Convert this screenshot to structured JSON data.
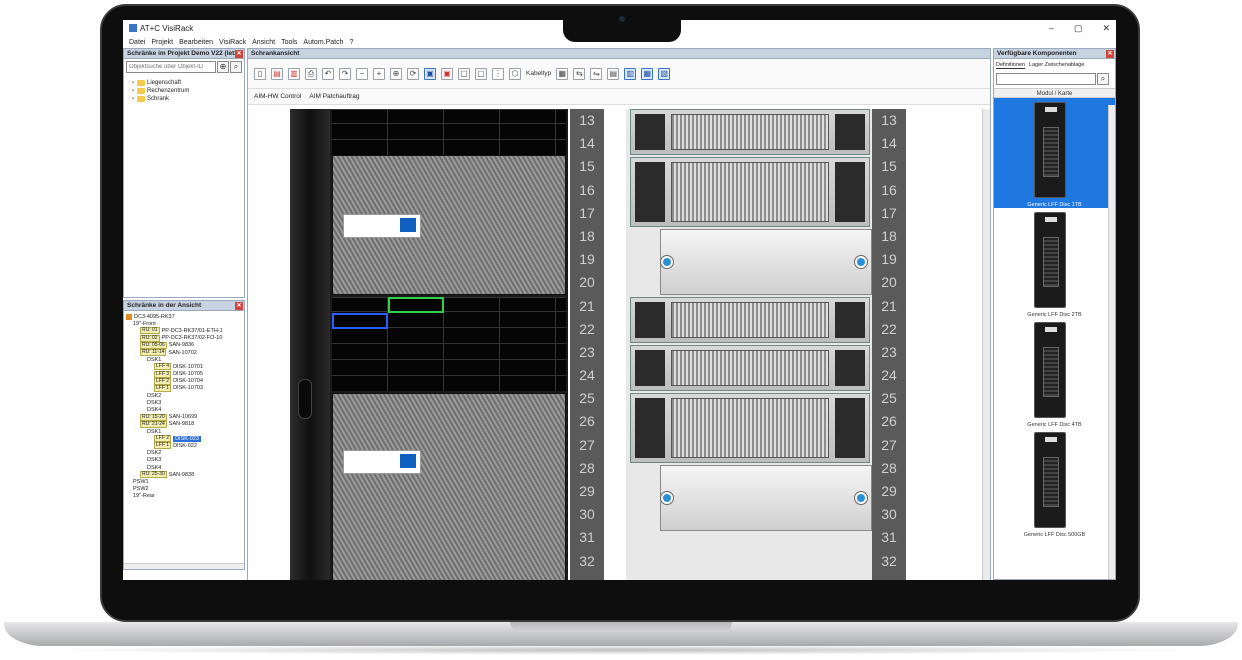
{
  "window": {
    "title": "AT+C VisiRack",
    "minimize": "–",
    "maximize": "▢",
    "close": "✕"
  },
  "menu": [
    "Datei",
    "Projekt",
    "Bearbeiten",
    "VisiRack",
    "Ansicht",
    "Tools",
    "Autom.Patch",
    "?"
  ],
  "left_top": {
    "title": "Schränke im Projekt Demo V22 (letzt",
    "search_placeholder": "Objektsuche über Objekt-ID",
    "tree": [
      "Liegenschaft",
      "Rechenzentrum",
      "Schrank"
    ]
  },
  "left_bottom": {
    "title": "Schränke in der Ansicht",
    "rows": [
      {
        "indent": 0,
        "tag": "",
        "text": "DC3-4095-RK37",
        "icon": true
      },
      {
        "indent": 1,
        "tag": "",
        "text": "19\"-Front"
      },
      {
        "indent": 2,
        "tag": "RU: 01",
        "text": "PP-DC3-RK37/01-ETH-1"
      },
      {
        "indent": 2,
        "tag": "RU: 02",
        "text": "PP-DC3-RK37/02-FO-10"
      },
      {
        "indent": 2,
        "tag": "RU: 05-06",
        "text": "SAN-9836"
      },
      {
        "indent": 2,
        "tag": "RU: 11-14",
        "text": "SAN-10702"
      },
      {
        "indent": 3,
        "tag": "",
        "text": "DSK1"
      },
      {
        "indent": 4,
        "tag": "LFF 4",
        "text": "DISK-10701"
      },
      {
        "indent": 4,
        "tag": "LFF 3",
        "text": "DISK-10705"
      },
      {
        "indent": 4,
        "tag": "LFF 2",
        "text": "DISK-10704"
      },
      {
        "indent": 4,
        "tag": "LFF 1",
        "text": "DISK-10703"
      },
      {
        "indent": 3,
        "tag": "",
        "text": "DSK2"
      },
      {
        "indent": 3,
        "tag": "",
        "text": "DSK3"
      },
      {
        "indent": 3,
        "tag": "",
        "text": "DSK4"
      },
      {
        "indent": 2,
        "tag": "RU: 15-20",
        "text": "SAN-10699"
      },
      {
        "indent": 2,
        "tag": "RU: 21-24",
        "text": "SAN-9818"
      },
      {
        "indent": 3,
        "tag": "",
        "text": "DSK1"
      },
      {
        "indent": 4,
        "tag": "LFF 2",
        "text": "DISK-023",
        "selected": true
      },
      {
        "indent": 4,
        "tag": "LFF 1",
        "text": "DISK-022"
      },
      {
        "indent": 3,
        "tag": "",
        "text": "DSK2"
      },
      {
        "indent": 3,
        "tag": "",
        "text": "DSK3"
      },
      {
        "indent": 3,
        "tag": "",
        "text": "DSK4"
      },
      {
        "indent": 2,
        "tag": "RU: 25-30",
        "text": "SAN-9838"
      },
      {
        "indent": 1,
        "tag": "",
        "text": "PSW1"
      },
      {
        "indent": 1,
        "tag": "",
        "text": "PSW2"
      },
      {
        "indent": 1,
        "tag": "",
        "text": "19\"-Rear"
      }
    ]
  },
  "center": {
    "title": "Schrankansicht",
    "cable_label": "Kabeltyp",
    "tabs": [
      "AIM-HW Control",
      "AIM Patchauftrag"
    ],
    "units": [
      "13",
      "14",
      "15",
      "16",
      "17",
      "18",
      "19",
      "20",
      "21",
      "22",
      "23",
      "24",
      "25",
      "26",
      "27",
      "28",
      "29",
      "30",
      "31",
      "32"
    ]
  },
  "right": {
    "title": "Verfügbare Komponenten",
    "tabs": [
      "Definitionen",
      "Lager Zwischenablage"
    ],
    "list_header": "Modul / Karte",
    "components": [
      "Generic LFF Disc 1TB",
      "Generic LFF Disc 2TB",
      "Generic LFF Disc 4TB",
      "Generic LFF Disc 500GB"
    ]
  }
}
